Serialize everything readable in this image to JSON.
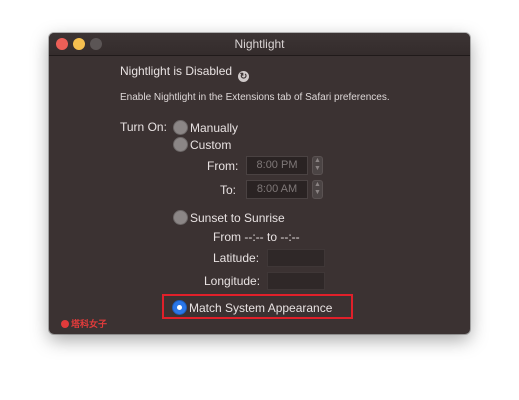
{
  "window": {
    "title": "Nightlight",
    "status_title": "Nightlight is Disabled",
    "status_message": "Enable Nightlight in the Extensions tab of Safari preferences."
  },
  "turn_on": {
    "label": "Turn On:",
    "options": {
      "manually": "Manually",
      "custom": "Custom",
      "sunset": "Sunset to Sunrise",
      "match": "Match System Appearance"
    },
    "selected": "Match System Appearance"
  },
  "custom": {
    "from_label": "From:",
    "from_value": "8:00 PM",
    "to_label": "To:",
    "to_value": "8:00 AM"
  },
  "sunset": {
    "range_text": "From --:-- to --:--",
    "latitude_label": "Latitude:",
    "longitude_label": "Longitude:"
  },
  "watermark": "塔科女子",
  "colors": {
    "window_bg": "#3b3232",
    "accent_radio": "#2a76e8",
    "highlight_border": "#e0202a"
  }
}
